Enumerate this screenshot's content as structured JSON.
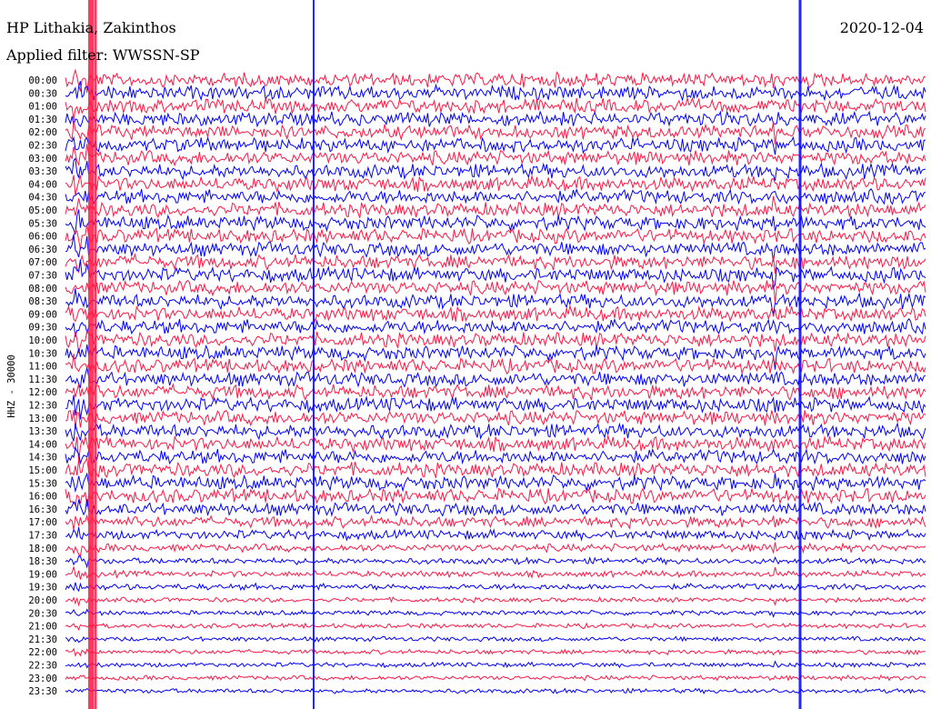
{
  "header": {
    "station": "HP Lithakia, Zakinthos",
    "date": "2020-12-04",
    "filter": "Applied filter: WWSSN-SP"
  },
  "colors": {
    "trace_a": "#ff1744",
    "trace_b": "#0000ff"
  },
  "chart_data": {
    "type": "line",
    "title": "HP Lithakia, Zakinthos",
    "ylabel": "HHZ - 30000",
    "xlabel": "",
    "date": "2020-12-04",
    "filter": "WWSSN-SP",
    "line_minutes": 30,
    "grid": false,
    "series_colors": [
      "#ff1744",
      "#0000ff"
    ],
    "row_labels": [
      "00:00",
      "00:30",
      "01:00",
      "01:30",
      "02:00",
      "02:30",
      "03:00",
      "03:30",
      "04:00",
      "04:30",
      "05:00",
      "05:30",
      "06:00",
      "06:30",
      "07:00",
      "07:30",
      "08:00",
      "08:30",
      "09:00",
      "09:30",
      "10:00",
      "10:30",
      "11:00",
      "11:30",
      "12:00",
      "12:30",
      "13:00",
      "13:30",
      "14:00",
      "14:30",
      "15:00",
      "15:30",
      "16:00",
      "16:30",
      "17:00",
      "17:30",
      "18:00",
      "18:30",
      "19:00",
      "19:30",
      "20:00",
      "20:30",
      "21:00",
      "21:30",
      "22:00",
      "22:30",
      "23:00",
      "23:30"
    ],
    "noise_level": [
      9,
      9,
      9,
      9,
      9,
      9,
      9,
      9,
      9,
      9,
      9,
      9,
      9,
      9,
      9,
      9,
      9,
      9,
      9,
      9,
      9,
      9,
      9,
      9,
      9,
      9,
      9,
      9,
      9,
      9,
      9,
      9,
      9,
      8,
      7,
      6,
      5,
      4,
      4,
      4,
      3,
      3,
      3,
      3,
      3,
      3,
      3,
      3
    ],
    "persistent_event_minutes": [
      3,
      5,
      247,
      7.5
    ]
  }
}
